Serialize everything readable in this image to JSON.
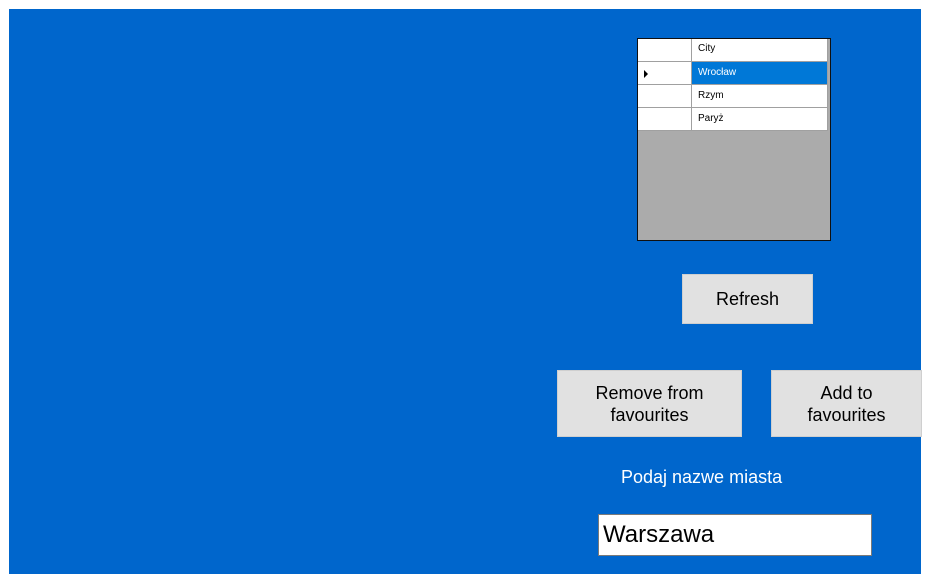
{
  "grid": {
    "column_header": "City",
    "rows": [
      {
        "city": "Wrocław",
        "selected": true
      },
      {
        "city": "Rzym",
        "selected": false
      },
      {
        "city": "Paryż",
        "selected": false
      }
    ]
  },
  "buttons": {
    "refresh": "Refresh",
    "remove_line1": "Remove from",
    "remove_line2": "favourites",
    "add_line1": "Add to",
    "add_line2": "favourites"
  },
  "city_label": "Podaj nazwe miasta",
  "city_input": {
    "value": "Warszawa"
  },
  "colors": {
    "form_background": "#0066cc",
    "selection": "#0078d7",
    "button": "#e1e1e1"
  }
}
